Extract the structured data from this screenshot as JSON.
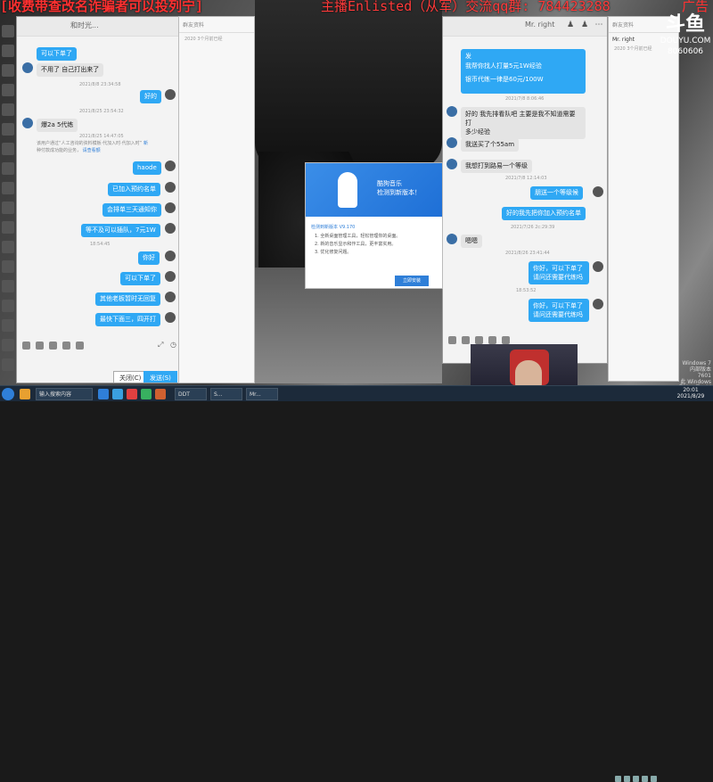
{
  "overlay": {
    "left_banner": "[收费带查改名诈骗者可以投列宁]",
    "mid_banner": "主播Enlisted（从军）交流qq群: 784423288",
    "right_banner": "广告",
    "logo": "斗鱼",
    "room_label": "DOUYU.COM",
    "room_number": "8060606"
  },
  "left_chat": {
    "title": "和时光...",
    "side_tab": "群友资料",
    "side_sub": "2020 3个月前已经",
    "messages": [
      {
        "who": "me",
        "text": "可以下单了"
      },
      {
        "who": "other",
        "text": "不用了 自己打出来了"
      },
      {
        "who": "ts",
        "text": "2021/8/8 23:34:58"
      },
      {
        "who": "me",
        "text": "好的"
      },
      {
        "who": "ts",
        "text": "2021/8/25 23:54:32"
      },
      {
        "who": "other",
        "text": "爆2a 5代练"
      },
      {
        "who": "ts",
        "text": "2021/8/25 14:47:05"
      },
      {
        "who": "sys1",
        "text": "该用户通过“人工咨询的资料模板·代加入时·代加入时”",
        "link": "新"
      },
      {
        "who": "sys2",
        "text": "种付款成功能的业务，",
        "link": "请查看额"
      },
      {
        "who": "me",
        "text": "haode"
      },
      {
        "who": "me",
        "text": "已加入预约名单"
      },
      {
        "who": "me",
        "text": "会排单三天通知你"
      },
      {
        "who": "me",
        "text": "等不及可以插队，7元1W"
      },
      {
        "who": "ts",
        "text": "18:54:45"
      },
      {
        "who": "me",
        "text": "你好"
      },
      {
        "who": "me",
        "text": "可以下单了"
      },
      {
        "who": "me",
        "text": "其他老板暂时无回复"
      },
      {
        "who": "me",
        "text": "最快下面三，四开打"
      }
    ],
    "close_btn": "关闭(C)",
    "send_btn": "发送(S)"
  },
  "right_chat": {
    "title": "Mr. right",
    "side_tab": "群友资料",
    "side_name": "Mr. right",
    "side_sub": "2020 3个月前已经",
    "messages": [
      {
        "who": "me",
        "text": "发"
      },
      {
        "who": "me",
        "text": "我帮你找人打量5元1W经验"
      },
      {
        "who": "me",
        "text": "银币代练一律是60元/100W"
      },
      {
        "who": "ts",
        "text": "2021/7/8 8:06:46"
      },
      {
        "who": "other",
        "text": "好的 我先排看队吧 主要是我不知道需要打"
      },
      {
        "who": "other",
        "text": "多少经验"
      },
      {
        "who": "other",
        "text": "我送买了个55am"
      },
      {
        "who": "other",
        "text": "我想打到路易一个等级"
      },
      {
        "who": "ts",
        "text": "2021/7/8 12:14:03"
      },
      {
        "who": "me",
        "text": "朋送一个等级候"
      },
      {
        "who": "me",
        "text": "好的我先把你加入预约名单"
      },
      {
        "who": "ts",
        "text": "2021/7/26 2c:29:39"
      },
      {
        "who": "other",
        "text": "嗯嗯"
      },
      {
        "who": "ts",
        "text": "2021/8/26 23:41:44"
      },
      {
        "who": "me",
        "text": "你好，可以下单了"
      },
      {
        "who": "me",
        "text": "请问还需要代练吗"
      },
      {
        "who": "ts",
        "text": "18:53:52"
      },
      {
        "who": "me",
        "text": "你好，可以下单了"
      },
      {
        "who": "me",
        "text": "请问还需要代练吗"
      }
    ]
  },
  "dialog": {
    "title_line1": "酷狗音乐",
    "title_line2": "检测到新版本！",
    "version": "检测到新版本 V9.170",
    "items": [
      "1. 全新桌面管理工具，轻松管理你的桌面。",
      "2. 新的音乐显示和作工具，更丰富实用。",
      "3. 优化修复问题。"
    ],
    "button": "立即安装"
  },
  "taskbar": {
    "item1": "输入搜索内容",
    "item2": "DDT",
    "item3": "S...",
    "item4": "Mr...",
    "clock_time": "20:01",
    "clock_date": "2021/8/29",
    "win_line1": "Windows 7",
    "win_line2": "内部版本 7601",
    "win_line3": "此 Windows 副本不是正版"
  },
  "colors": {
    "accent": "#2fa8f4",
    "red_text": "#ff3030"
  }
}
